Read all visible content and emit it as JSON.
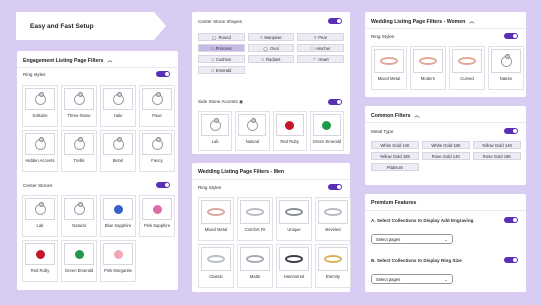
{
  "banner": {
    "title": "Easy and Fast Setup"
  },
  "left": {
    "header": "Engagement Listing Page Filters",
    "ring_styles": {
      "label": "Ring styles",
      "items": [
        "Solitaire",
        "Three-Stone",
        "Halo",
        "Pave",
        "Hidden Accents",
        "Trellis",
        "Bezel",
        "Fancy"
      ]
    },
    "center_stones": {
      "label": "Center Stones",
      "items": [
        "Lab",
        "Natural",
        "Blue Sapphire",
        "Pink Sapphire",
        "Red Ruby",
        "Green Emerald",
        "Pink Morganite"
      ]
    }
  },
  "middle": {
    "shapes": {
      "label": "Center Stone Shapes",
      "items": [
        "Round",
        "Marquise",
        "Pear",
        "Princess",
        "Oval",
        "Asscher",
        "Cushion",
        "Radiant",
        "Heart",
        "Emerald"
      ]
    },
    "side_stone": {
      "label": "Side Stone Accents",
      "items": [
        "Lab",
        "Natural",
        "Red Ruby",
        "Green Emerald"
      ]
    },
    "men": {
      "header": "Wedding Listing Page Filters - Men",
      "label": "Ring Styles",
      "items": [
        "Mixed Metal",
        "Comfort Fit",
        "Unique",
        "Beveled",
        "Classic",
        "Matte",
        "Hammered",
        "Eternity"
      ]
    }
  },
  "right": {
    "women": {
      "header": "Wedding Listing Page Filters - Women",
      "label": "Ring Styles",
      "items": [
        "Mixed Metal",
        "Modern",
        "Curved",
        "Nature"
      ]
    },
    "common": {
      "header": "Common Filters",
      "label": "Metal Type",
      "items": [
        "White Gold 14K",
        "White Gold 18K",
        "Yellow Gold 14K",
        "Yellow Gold 18K",
        "Rose Gold 14K",
        "Rose Gold 18K",
        "Platinum"
      ]
    },
    "premium": {
      "header": "Premium Features",
      "a_label": "A. Select Collections to Display Add Engraving",
      "b_label": "B. Select Collections to Display Ring Size",
      "select_placeholder": "Select pages"
    }
  },
  "colors": {
    "accent": "#5a2fb8",
    "highlight": "#c9bbe8",
    "background": "#d9ccf3"
  }
}
